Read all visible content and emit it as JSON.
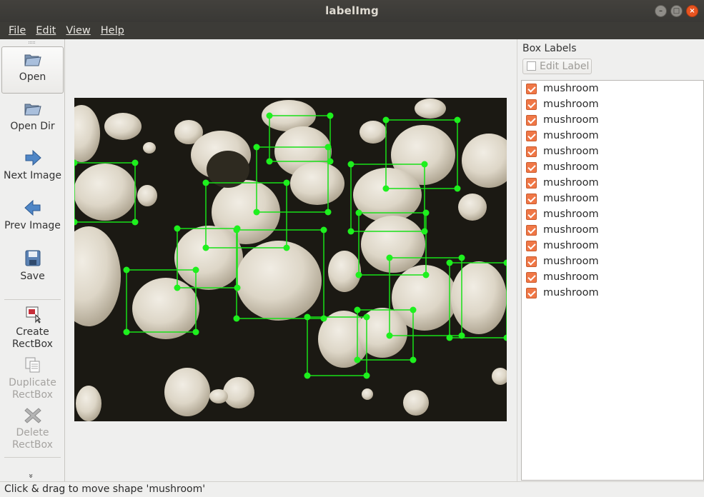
{
  "window": {
    "title": "labelImg"
  },
  "menu": [
    "File",
    "Edit",
    "View",
    "Help"
  ],
  "toolbar": {
    "open": "Open",
    "open_dir": "Open Dir",
    "next_image": "Next Image",
    "prev_image": "Prev Image",
    "save": "Save",
    "create_rectbox": [
      "Create",
      "RectBox"
    ],
    "duplicate_rectbox": [
      "Duplicate",
      "RectBox"
    ],
    "delete_rectbox": [
      "Delete",
      "RectBox"
    ],
    "more": "»"
  },
  "box_labels": {
    "title": "Box Labels",
    "edit_label": "Edit Label",
    "items": [
      "mushroom",
      "mushroom",
      "mushroom",
      "mushroom",
      "mushroom",
      "mushroom",
      "mushroom",
      "mushroom",
      "mushroom",
      "mushroom",
      "mushroom",
      "mushroom",
      "mushroom",
      "mushroom"
    ]
  },
  "status": "Click & drag to move shape 'mushroom'",
  "colors": {
    "box": "#00ff00",
    "titlebar": "#3c3b37",
    "check": "#f07746"
  }
}
